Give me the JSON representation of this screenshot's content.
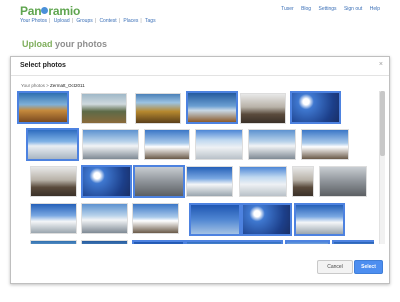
{
  "app": {
    "logo_text": "Pan",
    "logo_text_end": "ramio"
  },
  "topnav": [
    "Your Photos",
    "Upload",
    "Groups",
    "Contest",
    "Places",
    "Tags"
  ],
  "toplinks": [
    "Tuser",
    "Blog",
    "Settings",
    "Sign out",
    "Help"
  ],
  "page": {
    "heading_accent": "Upload",
    "heading_rest": " your photos"
  },
  "dialog": {
    "title": "Select photos",
    "close": "×",
    "crumbs": {
      "root": "Your photos",
      "sep": ">",
      "current": "Zermatt_Oct2011"
    },
    "cancel_label": "Cancel",
    "select_label": "Select"
  },
  "colors": {
    "accent": "#4d82e0",
    "logo_green": "#5fa54f"
  }
}
